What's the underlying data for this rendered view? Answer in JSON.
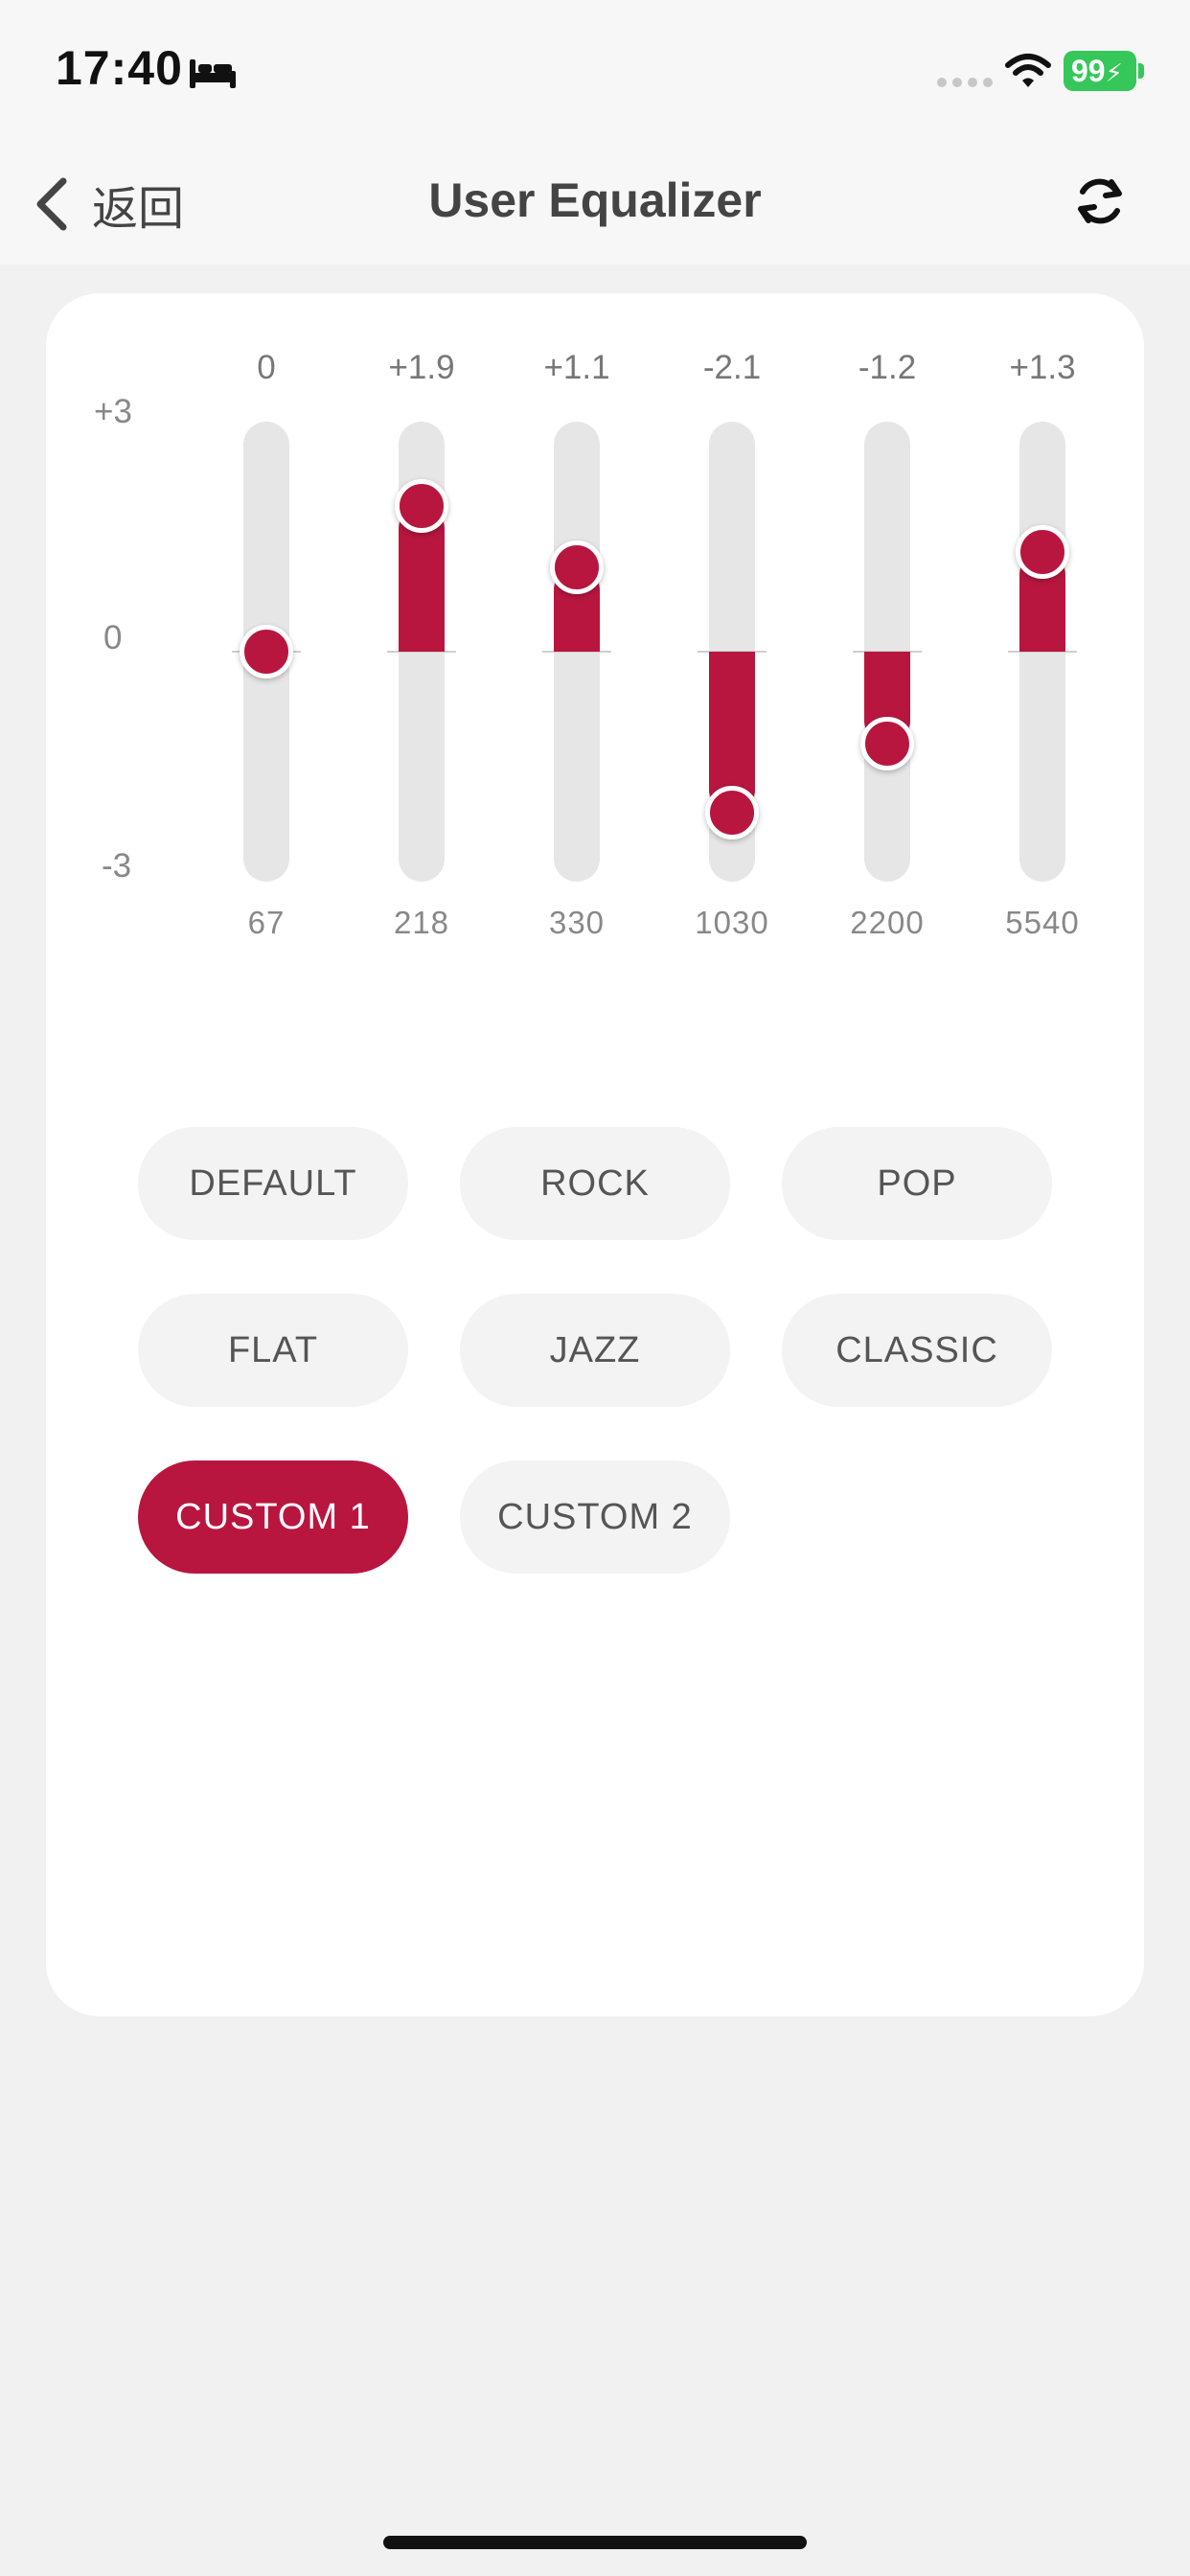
{
  "status": {
    "time": "17:40",
    "battery": "99"
  },
  "nav": {
    "back_label": "返回",
    "title": "User Equalizer"
  },
  "equalizer": {
    "scale": [
      "+3",
      "0",
      "-3"
    ],
    "bands": [
      {
        "freq": "67",
        "label": "0",
        "gain": 0
      },
      {
        "freq": "218",
        "label": "+1.9",
        "gain": 1.9
      },
      {
        "freq": "330",
        "label": "+1.1",
        "gain": 1.1
      },
      {
        "freq": "1030",
        "label": "-2.1",
        "gain": -2.1
      },
      {
        "freq": "2200",
        "label": "-1.2",
        "gain": -1.2
      },
      {
        "freq": "5540",
        "label": "+1.3",
        "gain": 1.3
      }
    ]
  },
  "presets": {
    "items": [
      "DEFAULT",
      "ROCK",
      "POP",
      "FLAT",
      "JAZZ",
      "CLASSIC",
      "CUSTOM 1",
      "CUSTOM 2"
    ],
    "selected": "CUSTOM 1"
  },
  "colors": {
    "accent": "#b8163f",
    "battery": "#35c759"
  },
  "icons": {
    "status": [
      "bed-icon",
      "cellular-signal-icon",
      "wifi-icon",
      "battery-icon"
    ],
    "nav": [
      "chevron-left-icon",
      "refresh-icon"
    ]
  }
}
